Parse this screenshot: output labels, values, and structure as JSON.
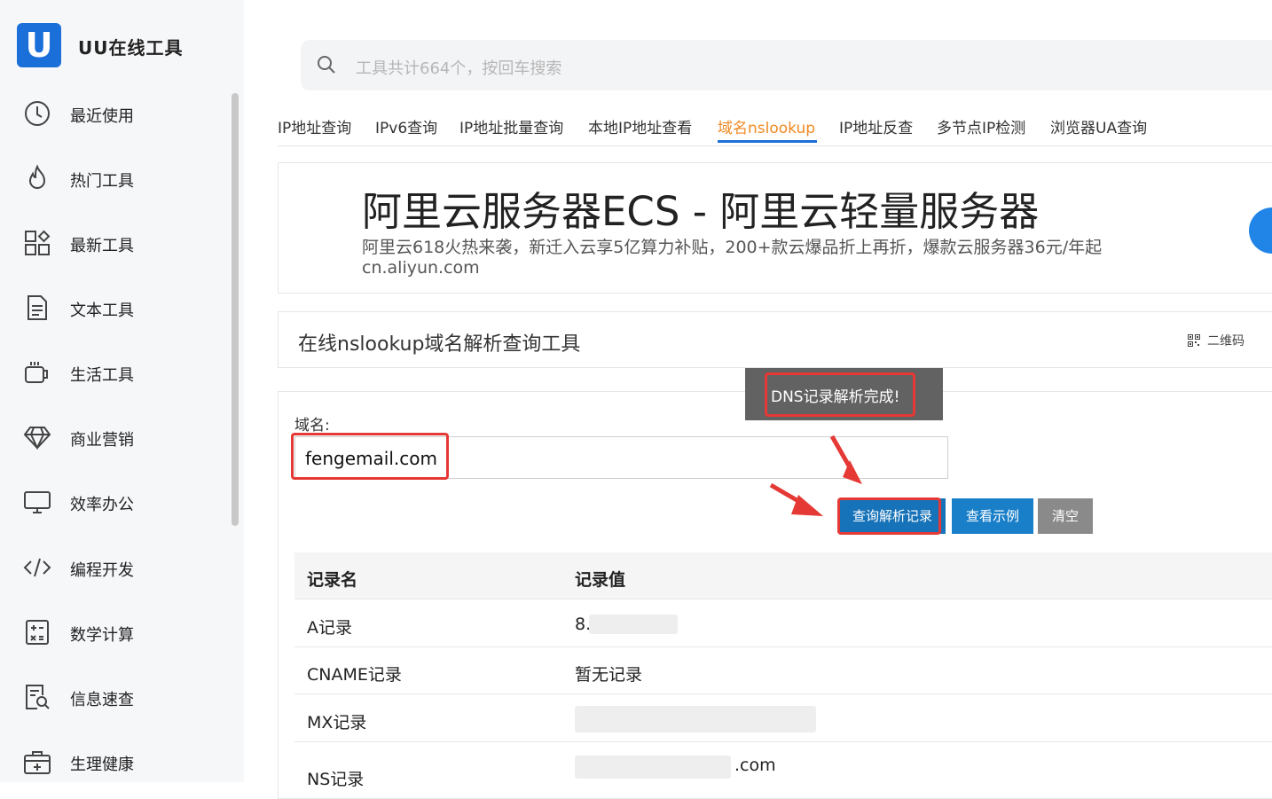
{
  "app": {
    "logo_letter": "U",
    "title": "UU在线工具"
  },
  "sidebar": {
    "items": [
      {
        "label": "最近使用",
        "icon": "clock-icon"
      },
      {
        "label": "热门工具",
        "icon": "flame-icon"
      },
      {
        "label": "最新工具",
        "icon": "grid-icon"
      },
      {
        "label": "文本工具",
        "icon": "document-icon"
      },
      {
        "label": "生活工具",
        "icon": "cup-icon"
      },
      {
        "label": "商业营销",
        "icon": "diamond-icon"
      },
      {
        "label": "效率办公",
        "icon": "monitor-icon"
      },
      {
        "label": "编程开发",
        "icon": "code-icon"
      },
      {
        "label": "数学计算",
        "icon": "calculator-icon"
      },
      {
        "label": "信息速查",
        "icon": "search-doc-icon"
      },
      {
        "label": "生理健康",
        "icon": "medkit-icon"
      }
    ]
  },
  "search": {
    "placeholder": "工具共计664个，按回车搜索"
  },
  "tabs": [
    "IP地址查询",
    "IPv6查询",
    "IP地址批量查询",
    "本地IP地址查看",
    "域名nslookup",
    "IP地址反查",
    "多节点IP检测",
    "浏览器UA查询"
  ],
  "active_tab": "域名nslookup",
  "ad": {
    "title": "阿里云服务器ECS - 阿里云轻量服务器",
    "description": "阿里云618火热来袭，新迁入云享5亿算力补贴，200+款云爆品折上再折，爆款云服务器36元/年起",
    "url": "cn.aliyun.com"
  },
  "tool": {
    "title": "在线nslookup域名解析查询工具",
    "qr_label": "二维码"
  },
  "form": {
    "domain_label": "域名:",
    "domain_value": "fengemail.com"
  },
  "toast": "DNS记录解析完成!",
  "buttons": {
    "query": "查询解析记录",
    "example": "查看示例",
    "clear": "清空"
  },
  "table": {
    "headers": [
      "记录名",
      "记录值"
    ],
    "rows": [
      {
        "name": "A记录",
        "value": "8."
      },
      {
        "name": "CNAME记录",
        "value": "暂无记录"
      },
      {
        "name": "MX记录",
        "value": ""
      },
      {
        "name": "NS记录",
        "value": ".com"
      }
    ]
  },
  "colors": {
    "accent": "#1a6fd8",
    "active_tab": "#f08a24",
    "highlight": "#e53935"
  }
}
